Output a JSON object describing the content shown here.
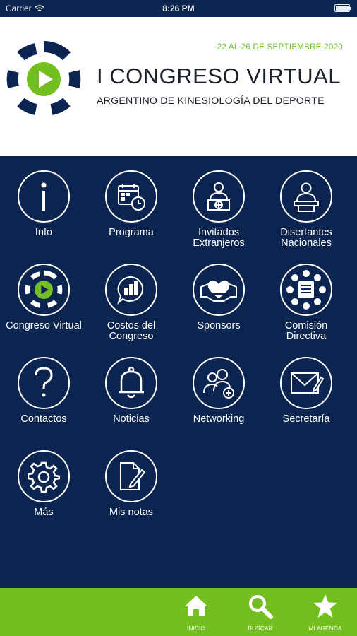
{
  "status": {
    "carrier": "Carrier",
    "time": "8:26 PM"
  },
  "header": {
    "dates": "22 AL 26 DE SEPTIEMBRE 2020",
    "title": "I CONGRESO VIRTUAL",
    "subtitle": "ARGENTINO DE KINESIOLOGÍA DEL DEPORTE"
  },
  "colors": {
    "navy": "#0c2550",
    "green": "#72bf1f",
    "white": "#ffffff"
  },
  "menu": [
    {
      "label": "Info",
      "icon": "info-icon"
    },
    {
      "label": "Programa",
      "icon": "calendar-clock-icon"
    },
    {
      "label": "Invitados\nExtranjeros",
      "icon": "speaker-globe-icon"
    },
    {
      "label": "Disertantes\nNacionales",
      "icon": "speaker-podium-icon"
    },
    {
      "label": "Congreso Virtual",
      "icon": "congress-logo-icon"
    },
    {
      "label": "Costos del\nCongreso",
      "icon": "chart-bubble-icon"
    },
    {
      "label": "Sponsors",
      "icon": "handshake-heart-icon"
    },
    {
      "label": "Comisión\nDirectiva",
      "icon": "committee-icon"
    },
    {
      "label": "Contactos",
      "icon": "question-icon"
    },
    {
      "label": "Noticias",
      "icon": "bell-icon"
    },
    {
      "label": "Networking",
      "icon": "users-add-icon"
    },
    {
      "label": "Secretaría",
      "icon": "envelope-pen-icon"
    },
    {
      "label": "Más",
      "icon": "gear-icon"
    },
    {
      "label": "Mis notas",
      "icon": "note-pen-icon"
    }
  ],
  "tabs": [
    {
      "label": "INICIO",
      "icon": "home-icon"
    },
    {
      "label": "BUSCAR",
      "icon": "search-icon"
    },
    {
      "label": "MI AGENDA",
      "icon": "star-icon"
    }
  ]
}
